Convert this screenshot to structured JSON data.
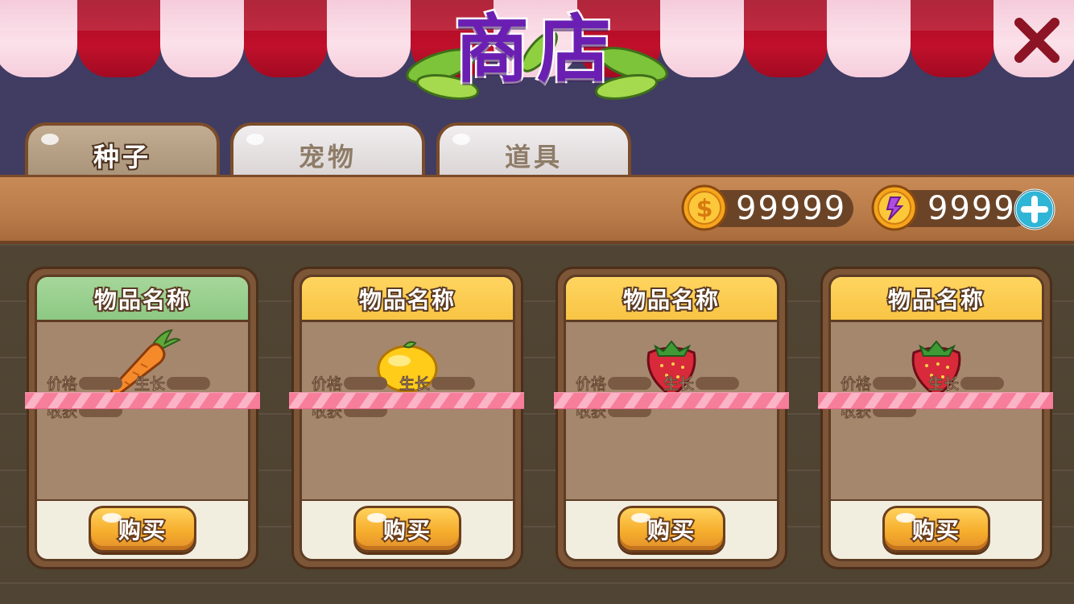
{
  "title": "商店",
  "tabs": [
    {
      "label": "种子",
      "active": true
    },
    {
      "label": "宠物",
      "active": false
    },
    {
      "label": "道具",
      "active": false
    }
  ],
  "currency": {
    "coins": "99999",
    "gems": "9999"
  },
  "stat_labels": {
    "price": "价格",
    "growth": "生长",
    "harvest": "收获"
  },
  "items": [
    {
      "name": "物品名称",
      "icon": "carrot-icon",
      "header_color": "#9ccf91",
      "buy_label": "购买"
    },
    {
      "name": "物品名称",
      "icon": "lemon-icon",
      "header_color": "#fbcc50",
      "buy_label": "购买"
    },
    {
      "name": "物品名称",
      "icon": "strawberry-icon",
      "header_color": "#fbcc50",
      "buy_label": "购买"
    },
    {
      "name": "物品名称",
      "icon": "strawberry-icon",
      "header_color": "#fbcc50",
      "buy_label": "购买"
    }
  ],
  "colors": {
    "title": "#6a1fb2",
    "awning_red": "#b30c25",
    "awning_pink": "#f8d3e0",
    "background_navy": "#413c62",
    "wood": "#bb7c4a"
  }
}
